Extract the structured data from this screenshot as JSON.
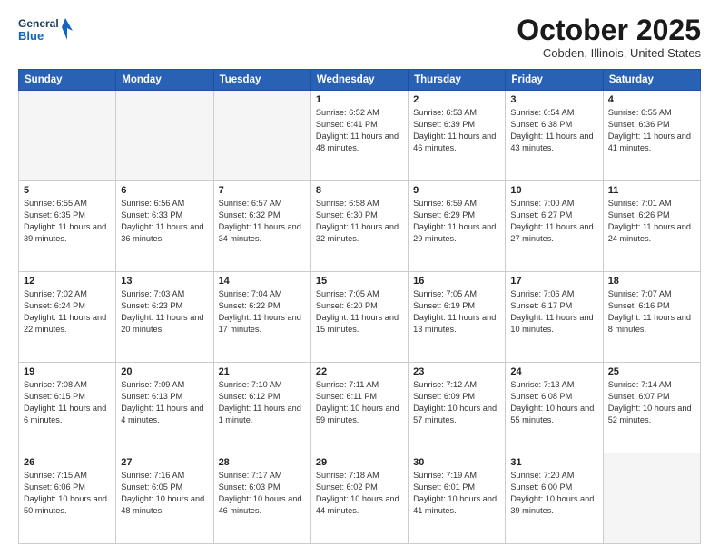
{
  "header": {
    "logo_line1": "General",
    "logo_line2": "Blue",
    "month": "October 2025",
    "location": "Cobden, Illinois, United States"
  },
  "days": [
    "Sunday",
    "Monday",
    "Tuesday",
    "Wednesday",
    "Thursday",
    "Friday",
    "Saturday"
  ],
  "weeks": [
    [
      {
        "day": "",
        "content": ""
      },
      {
        "day": "",
        "content": ""
      },
      {
        "day": "",
        "content": ""
      },
      {
        "day": "1",
        "content": "Sunrise: 6:52 AM\nSunset: 6:41 PM\nDaylight: 11 hours\nand 48 minutes."
      },
      {
        "day": "2",
        "content": "Sunrise: 6:53 AM\nSunset: 6:39 PM\nDaylight: 11 hours\nand 46 minutes."
      },
      {
        "day": "3",
        "content": "Sunrise: 6:54 AM\nSunset: 6:38 PM\nDaylight: 11 hours\nand 43 minutes."
      },
      {
        "day": "4",
        "content": "Sunrise: 6:55 AM\nSunset: 6:36 PM\nDaylight: 11 hours\nand 41 minutes."
      }
    ],
    [
      {
        "day": "5",
        "content": "Sunrise: 6:55 AM\nSunset: 6:35 PM\nDaylight: 11 hours\nand 39 minutes."
      },
      {
        "day": "6",
        "content": "Sunrise: 6:56 AM\nSunset: 6:33 PM\nDaylight: 11 hours\nand 36 minutes."
      },
      {
        "day": "7",
        "content": "Sunrise: 6:57 AM\nSunset: 6:32 PM\nDaylight: 11 hours\nand 34 minutes."
      },
      {
        "day": "8",
        "content": "Sunrise: 6:58 AM\nSunset: 6:30 PM\nDaylight: 11 hours\nand 32 minutes."
      },
      {
        "day": "9",
        "content": "Sunrise: 6:59 AM\nSunset: 6:29 PM\nDaylight: 11 hours\nand 29 minutes."
      },
      {
        "day": "10",
        "content": "Sunrise: 7:00 AM\nSunset: 6:27 PM\nDaylight: 11 hours\nand 27 minutes."
      },
      {
        "day": "11",
        "content": "Sunrise: 7:01 AM\nSunset: 6:26 PM\nDaylight: 11 hours\nand 24 minutes."
      }
    ],
    [
      {
        "day": "12",
        "content": "Sunrise: 7:02 AM\nSunset: 6:24 PM\nDaylight: 11 hours\nand 22 minutes."
      },
      {
        "day": "13",
        "content": "Sunrise: 7:03 AM\nSunset: 6:23 PM\nDaylight: 11 hours\nand 20 minutes."
      },
      {
        "day": "14",
        "content": "Sunrise: 7:04 AM\nSunset: 6:22 PM\nDaylight: 11 hours\nand 17 minutes."
      },
      {
        "day": "15",
        "content": "Sunrise: 7:05 AM\nSunset: 6:20 PM\nDaylight: 11 hours\nand 15 minutes."
      },
      {
        "day": "16",
        "content": "Sunrise: 7:05 AM\nSunset: 6:19 PM\nDaylight: 11 hours\nand 13 minutes."
      },
      {
        "day": "17",
        "content": "Sunrise: 7:06 AM\nSunset: 6:17 PM\nDaylight: 11 hours\nand 10 minutes."
      },
      {
        "day": "18",
        "content": "Sunrise: 7:07 AM\nSunset: 6:16 PM\nDaylight: 11 hours\nand 8 minutes."
      }
    ],
    [
      {
        "day": "19",
        "content": "Sunrise: 7:08 AM\nSunset: 6:15 PM\nDaylight: 11 hours\nand 6 minutes."
      },
      {
        "day": "20",
        "content": "Sunrise: 7:09 AM\nSunset: 6:13 PM\nDaylight: 11 hours\nand 4 minutes."
      },
      {
        "day": "21",
        "content": "Sunrise: 7:10 AM\nSunset: 6:12 PM\nDaylight: 11 hours\nand 1 minute."
      },
      {
        "day": "22",
        "content": "Sunrise: 7:11 AM\nSunset: 6:11 PM\nDaylight: 10 hours\nand 59 minutes."
      },
      {
        "day": "23",
        "content": "Sunrise: 7:12 AM\nSunset: 6:09 PM\nDaylight: 10 hours\nand 57 minutes."
      },
      {
        "day": "24",
        "content": "Sunrise: 7:13 AM\nSunset: 6:08 PM\nDaylight: 10 hours\nand 55 minutes."
      },
      {
        "day": "25",
        "content": "Sunrise: 7:14 AM\nSunset: 6:07 PM\nDaylight: 10 hours\nand 52 minutes."
      }
    ],
    [
      {
        "day": "26",
        "content": "Sunrise: 7:15 AM\nSunset: 6:06 PM\nDaylight: 10 hours\nand 50 minutes."
      },
      {
        "day": "27",
        "content": "Sunrise: 7:16 AM\nSunset: 6:05 PM\nDaylight: 10 hours\nand 48 minutes."
      },
      {
        "day": "28",
        "content": "Sunrise: 7:17 AM\nSunset: 6:03 PM\nDaylight: 10 hours\nand 46 minutes."
      },
      {
        "day": "29",
        "content": "Sunrise: 7:18 AM\nSunset: 6:02 PM\nDaylight: 10 hours\nand 44 minutes."
      },
      {
        "day": "30",
        "content": "Sunrise: 7:19 AM\nSunset: 6:01 PM\nDaylight: 10 hours\nand 41 minutes."
      },
      {
        "day": "31",
        "content": "Sunrise: 7:20 AM\nSunset: 6:00 PM\nDaylight: 10 hours\nand 39 minutes."
      },
      {
        "day": "",
        "content": ""
      }
    ]
  ]
}
